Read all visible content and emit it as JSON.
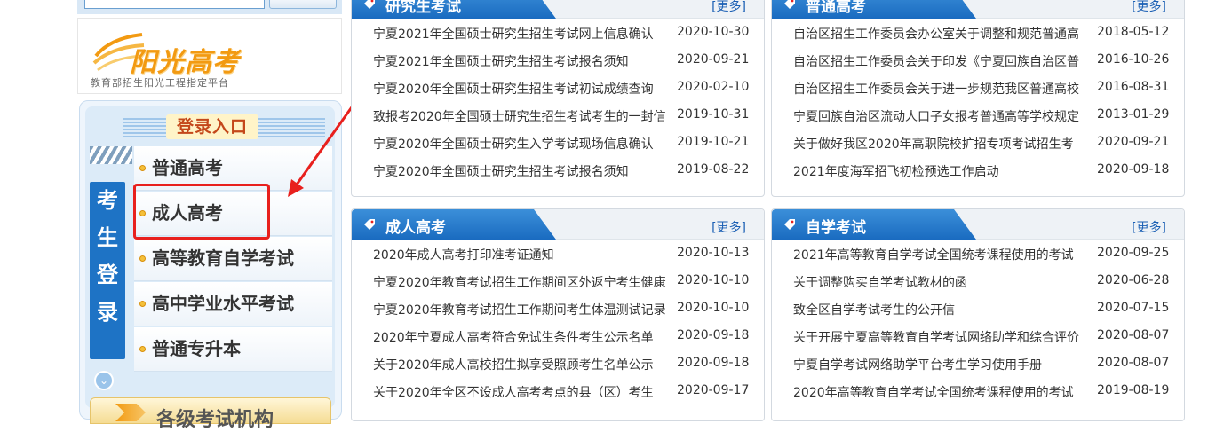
{
  "sun_banner": {
    "logo_text": "阳光高考",
    "subtitle": "教育部招生阳光工程指定平台"
  },
  "login": {
    "title": "登录入口",
    "side_label": [
      "考",
      "生",
      "登",
      "录"
    ],
    "items": [
      {
        "label": "普通高考"
      },
      {
        "label": "成人高考"
      },
      {
        "label": "高等教育自学考试"
      },
      {
        "label": "高中学业水平考试"
      },
      {
        "label": "普通专升本"
      }
    ],
    "bottom_tab_label": "各级考试机构"
  },
  "colors": {
    "accent_blue": "#1a6bc0",
    "annotation_red": "#e8201d"
  },
  "panels": [
    {
      "title": "研究生考试",
      "more": "[更多]",
      "items": [
        {
          "title": "宁夏2021年全国硕士研究生招生考试网上信息确认",
          "date": "2020-10-30"
        },
        {
          "title": "宁夏2021年全国硕士研究生招生考试报名须知",
          "date": "2020-09-21"
        },
        {
          "title": "宁夏2020年全国硕士研究生招生考试初试成绩查询",
          "date": "2020-02-10"
        },
        {
          "title": "致报考2020年全国硕士研究生招生考试考生的一封信",
          "date": "2019-10-31"
        },
        {
          "title": "宁夏2020年全国硕士研究生入学考试现场信息确认",
          "date": "2019-10-21"
        },
        {
          "title": "宁夏2020年全国硕士研究生招生考试报名须知",
          "date": "2019-08-22"
        }
      ]
    },
    {
      "title": "普通高考",
      "more": "[更多]",
      "items": [
        {
          "title": "自治区招生工作委员会办公室关于调整和规范普通高",
          "date": "2018-05-12"
        },
        {
          "title": "自治区招生工作委员会关于印发《宁夏回族自治区普",
          "date": "2016-10-26"
        },
        {
          "title": "自治区招生工作委员会关于进一步规范我区普通高校",
          "date": "2016-08-31"
        },
        {
          "title": "宁夏回族自治区流动人口子女报考普通高等学校规定",
          "date": "2013-01-29"
        },
        {
          "title": "关于做好我区2020年高职院校扩招专项考试招生考",
          "date": "2020-09-21"
        },
        {
          "title": "2021年度海军招飞初检预选工作启动",
          "date": "2020-09-18"
        }
      ]
    },
    {
      "title": "成人高考",
      "more": "[更多]",
      "items": [
        {
          "title": "2020年成人高考打印准考证通知",
          "date": "2020-10-13"
        },
        {
          "title": "宁夏2020年教育考试招生工作期间区外返宁考生健康",
          "date": "2020-10-10"
        },
        {
          "title": "宁夏2020年教育考试招生工作期间考生体温测试记录",
          "date": "2020-10-10"
        },
        {
          "title": "2020年宁夏成人高考符合免试生条件考生公示名单",
          "date": "2020-09-18"
        },
        {
          "title": "关于2020年成人高校招生拟享受照顾考生名单公示",
          "date": "2020-09-18"
        },
        {
          "title": "关于2020年全区不设成人高考考点的县（区）考生",
          "date": "2020-09-17"
        }
      ]
    },
    {
      "title": "自学考试",
      "more": "[更多]",
      "items": [
        {
          "title": "2021年高等教育自学考试全国统考课程使用的考试",
          "date": "2020-09-25"
        },
        {
          "title": "关于调整购买自学考试教材的函",
          "date": "2020-06-28"
        },
        {
          "title": "致全区自学考试考生的公开信",
          "date": "2020-07-15"
        },
        {
          "title": "关于开展宁夏高等教育自学考试网络助学和综合评价",
          "date": "2020-08-07"
        },
        {
          "title": "宁夏自学考试网络助学平台考生学习使用手册",
          "date": "2020-08-07"
        },
        {
          "title": "2020年高等教育自学考试全国统考课程使用的考试",
          "date": "2019-08-19"
        }
      ]
    }
  ]
}
